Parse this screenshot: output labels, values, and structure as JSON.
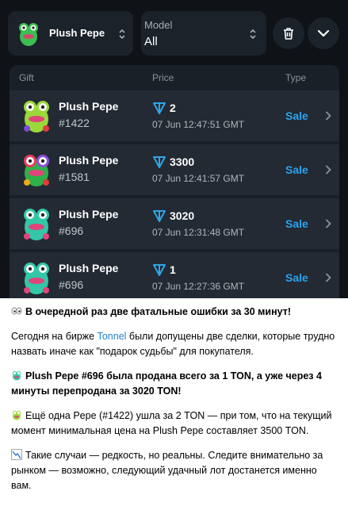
{
  "filters": {
    "gift_label": "Plush Pepe",
    "model_caption": "Model",
    "model_value": "All"
  },
  "table": {
    "headers": {
      "gift": "Gift",
      "price": "Price",
      "type": "Type"
    },
    "rows": [
      {
        "name": "Plush Pepe",
        "number": "#1422",
        "price": "2",
        "date": "07 Jun 12:47:51 GMT",
        "type": "Sale"
      },
      {
        "name": "Plush Pepe",
        "number": "#1581",
        "price": "3300",
        "date": "07 Jun 12:41:57 GMT",
        "type": "Sale"
      },
      {
        "name": "Plush Pepe",
        "number": "#696",
        "price": "3020",
        "date": "07 Jun 12:31:48 GMT",
        "type": "Sale"
      },
      {
        "name": "Plush Pepe",
        "number": "#696",
        "price": "1",
        "date": "07 Jun 12:27:36 GMT",
        "type": "Sale"
      }
    ]
  },
  "post": {
    "headline": "В очередной раз две фатальные ошибки за 30 минут!",
    "p1_before": "Сегодня на бирже ",
    "p1_link": "Tonnel",
    "p1_after": " были допущены две сделки, которые трудно назвать иначе как \"подарок судьбы\" для покупателя.",
    "p2": "Plush Pepe #696 была продана всего за 1 TON, а уже через 4 минуты перепродана за 3020 TON!",
    "p3": "Ещё одна Pepe (#1422) ушла за 2 TON — при том, что на текущий момент минимальная цена на Plush Pepe составляет 3500 TON.",
    "p4": "Такие случаи — редкость, но реальны. Следите внимательно за рынком — возможно, следующий удачный лот достанется именно вам."
  },
  "colors": {
    "accent": "#2aa3f0",
    "ton": "#2ea6e8",
    "panel": "#1c222a",
    "row": "#232a33",
    "link": "#2481cc"
  },
  "icons": [
    "pepe-thumb-icon",
    "updown-icon",
    "trash-icon",
    "chevron-down-icon",
    "ton-icon",
    "chevron-right-icon",
    "eyes-emoji-icon",
    "frog-emoji-icon",
    "chart-emoji-icon"
  ]
}
